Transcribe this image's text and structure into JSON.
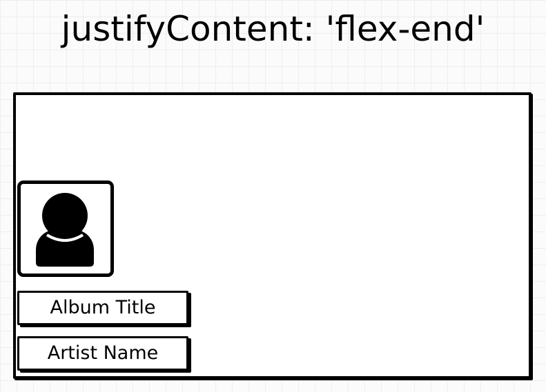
{
  "title": "justifyContent: 'flex-end'",
  "diagram": {
    "avatar_icon": "user-silhouette-icon",
    "album_title": "Album Title",
    "artist_name": "Artist Name"
  }
}
